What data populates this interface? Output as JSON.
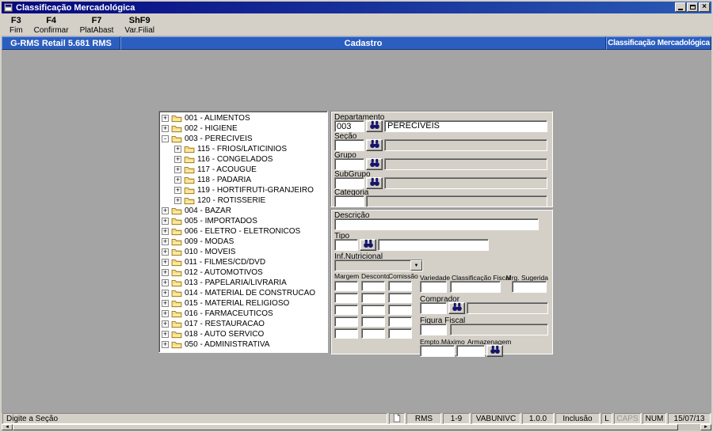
{
  "window": {
    "title": "Classificação Mercadológica"
  },
  "icons": {
    "close": "×",
    "dropdown": "▼",
    "scroll_left": "◄",
    "scroll_right": "►",
    "expand": "+",
    "collapse": "-"
  },
  "toolbar": {
    "items": [
      {
        "key": "F3",
        "label": "Fim"
      },
      {
        "key": "F4",
        "label": "Confirmar"
      },
      {
        "key": "F7",
        "label": "PlatAbast"
      },
      {
        "key": "ShF9",
        "label": "Var.Filial"
      }
    ]
  },
  "header": {
    "left": "G-RMS Retail 5.681 RMS",
    "center": "Cadastro",
    "right": "Classificação Mercadológica"
  },
  "tree": {
    "items": [
      {
        "label": "001 - ALIMENTOS",
        "level": 0,
        "state": "collapsed"
      },
      {
        "label": "002 - HIGIENE",
        "level": 0,
        "state": "collapsed"
      },
      {
        "label": "003 - PERECIVEIS",
        "level": 0,
        "state": "expanded"
      },
      {
        "label": "115 - FRIOS/LATICINIOS",
        "level": 1,
        "state": "collapsed"
      },
      {
        "label": "116 - CONGELADOS",
        "level": 1,
        "state": "collapsed"
      },
      {
        "label": "117 - ACOUGUE",
        "level": 1,
        "state": "collapsed"
      },
      {
        "label": "118 - PADARIA",
        "level": 1,
        "state": "collapsed"
      },
      {
        "label": "119 - HORTIFRUTI-GRANJEIRO",
        "level": 1,
        "state": "collapsed"
      },
      {
        "label": "120 - ROTISSERIE",
        "level": 1,
        "state": "collapsed"
      },
      {
        "label": "004 - BAZAR",
        "level": 0,
        "state": "collapsed"
      },
      {
        "label": "005 - IMPORTADOS",
        "level": 0,
        "state": "collapsed"
      },
      {
        "label": "006 - ELETRO - ELETRONICOS",
        "level": 0,
        "state": "collapsed"
      },
      {
        "label": "009 - MODAS",
        "level": 0,
        "state": "collapsed"
      },
      {
        "label": "010 - MOVEIS",
        "level": 0,
        "state": "collapsed"
      },
      {
        "label": "011 - FILMES/CD/DVD",
        "level": 0,
        "state": "collapsed"
      },
      {
        "label": "012 - AUTOMOTIVOS",
        "level": 0,
        "state": "collapsed"
      },
      {
        "label": "013 - PAPELARIA/LIVRARIA",
        "level": 0,
        "state": "collapsed"
      },
      {
        "label": "014 - MATERIAL DE CONSTRUCAO",
        "level": 0,
        "state": "collapsed"
      },
      {
        "label": "015 - MATERIAL RELIGIOSO",
        "level": 0,
        "state": "collapsed"
      },
      {
        "label": "016 - FARMACEUTICOS",
        "level": 0,
        "state": "collapsed"
      },
      {
        "label": "017 - RESTAURACAO",
        "level": 0,
        "state": "collapsed"
      },
      {
        "label": "018 - AUTO SERVICO",
        "level": 0,
        "state": "collapsed"
      },
      {
        "label": "050 - ADMINISTRATIVA",
        "level": 0,
        "state": "collapsed"
      }
    ]
  },
  "form": {
    "departamento": {
      "label": "Departamento",
      "code": "003",
      "name": "PERECIVEIS"
    },
    "secao": {
      "label": "Seção",
      "code": "",
      "name": ""
    },
    "grupo": {
      "label": "Grupo",
      "code": "",
      "name": ""
    },
    "subgrupo": {
      "label": "SubGrupo",
      "code": "",
      "name": ""
    },
    "categoria": {
      "label": "Categoria",
      "code": "",
      "name": ""
    },
    "descricao": {
      "label": "Descrição",
      "value": ""
    },
    "tipo": {
      "label": "Tipo",
      "code": "",
      "name": ""
    },
    "inf_nutricional": {
      "label": "Inf.Nutricional",
      "value": ""
    },
    "grid": {
      "columns": [
        "Margem",
        "Desconto",
        "Comissão"
      ],
      "rows": 5
    },
    "variedade": {
      "label": "Variedade",
      "value": ""
    },
    "classificacao_fiscal": {
      "label": "Classificação Fiscal",
      "value": ""
    },
    "mrg_sugerida": {
      "label": "Mrg. Sugerida",
      "value": ""
    },
    "comprador": {
      "label": "Comprador",
      "code": "",
      "name": ""
    },
    "figura_fiscal": {
      "label": "Figura Fiscal",
      "code": "",
      "name": ""
    },
    "empto_maximo": {
      "label": "Empto.Máximo",
      "value": ""
    },
    "armazenagem": {
      "label": "Armazenagem",
      "value": ""
    }
  },
  "statusbar": {
    "hint": "Digite a Seção",
    "panels": [
      {
        "text": "RMS",
        "muted": false
      },
      {
        "text": "1-9",
        "muted": false
      },
      {
        "text": "VABUNIVC",
        "muted": false
      },
      {
        "text": "1.0.0",
        "muted": false
      },
      {
        "text": "Inclusão",
        "muted": false
      },
      {
        "text": "L",
        "muted": false
      },
      {
        "text": "CAPS",
        "muted": true
      },
      {
        "text": "NUM",
        "muted": false
      },
      {
        "text": "15/07/13",
        "muted": false
      }
    ]
  }
}
